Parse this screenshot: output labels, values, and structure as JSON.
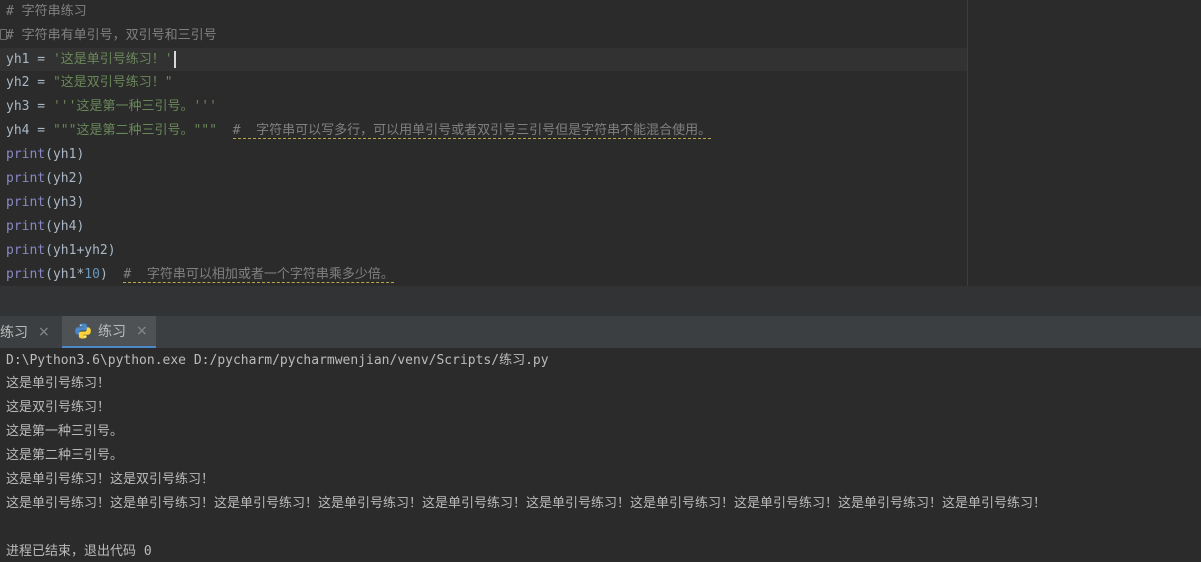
{
  "editor": {
    "lines": [
      {
        "segments": [
          {
            "text": "# 字符串练习",
            "cls": "comment"
          }
        ]
      },
      {
        "segments": [
          {
            "text": "# 字符串有单引号，双引号和三引号",
            "cls": "comment"
          }
        ]
      },
      {
        "segments": [
          {
            "text": "yh1 = ",
            "cls": ""
          },
          {
            "text": "'这是单引号练习！'",
            "cls": "string"
          }
        ],
        "current": true
      },
      {
        "segments": [
          {
            "text": "yh2 = ",
            "cls": ""
          },
          {
            "text": "\"这是双引号练习！\"",
            "cls": "string"
          }
        ]
      },
      {
        "segments": [
          {
            "text": "yh3 = ",
            "cls": ""
          },
          {
            "text": "'''这是第一种三引号。'''",
            "cls": "string"
          }
        ]
      },
      {
        "segments": [
          {
            "text": "yh4 = ",
            "cls": ""
          },
          {
            "text": "\"\"\"这是第二种三引号。\"\"\"",
            "cls": "string"
          },
          {
            "text": "  ",
            "cls": ""
          },
          {
            "text": "#  字符串可以写多行，可以用单引号或者双引号三引号但是字符串不能混合使用。",
            "cls": "comment typo"
          }
        ]
      },
      {
        "segments": [
          {
            "text": "print",
            "cls": "builtin"
          },
          {
            "text": "(yh1)",
            "cls": ""
          }
        ]
      },
      {
        "segments": [
          {
            "text": "print",
            "cls": "builtin"
          },
          {
            "text": "(yh2)",
            "cls": ""
          }
        ]
      },
      {
        "segments": [
          {
            "text": "print",
            "cls": "builtin"
          },
          {
            "text": "(yh3)",
            "cls": ""
          }
        ]
      },
      {
        "segments": [
          {
            "text": "print",
            "cls": "builtin"
          },
          {
            "text": "(yh4)",
            "cls": ""
          }
        ]
      },
      {
        "segments": [
          {
            "text": "print",
            "cls": "builtin"
          },
          {
            "text": "(yh1+yh2)",
            "cls": ""
          }
        ]
      },
      {
        "segments": [
          {
            "text": "print",
            "cls": "builtin"
          },
          {
            "text": "(yh1*",
            "cls": ""
          },
          {
            "text": "10",
            "cls": "num"
          },
          {
            "text": ")  ",
            "cls": ""
          },
          {
            "text": "#  字符串可以相加或者一个字符串乘多少倍。",
            "cls": "comment typo"
          }
        ]
      }
    ]
  },
  "run_tabs": [
    {
      "label": "练习",
      "close": "×",
      "active": false
    },
    {
      "label": "练习",
      "close": "×",
      "active": true,
      "icon": "python-icon"
    }
  ],
  "console": {
    "lines": [
      "D:\\Python3.6\\python.exe D:/pycharm/pycharmwenjian/venv/Scripts/练习.py",
      "这是单引号练习！",
      "这是双引号练习！",
      "这是第一种三引号。",
      "这是第二种三引号。",
      "这是单引号练习！这是双引号练习！",
      "这是单引号练习！这是单引号练习！这是单引号练习！这是单引号练习！这是单引号练习！这是单引号练习！这是单引号练习！这是单引号练习！这是单引号练习！这是单引号练习！",
      "",
      "进程已结束，退出代码 0"
    ]
  }
}
